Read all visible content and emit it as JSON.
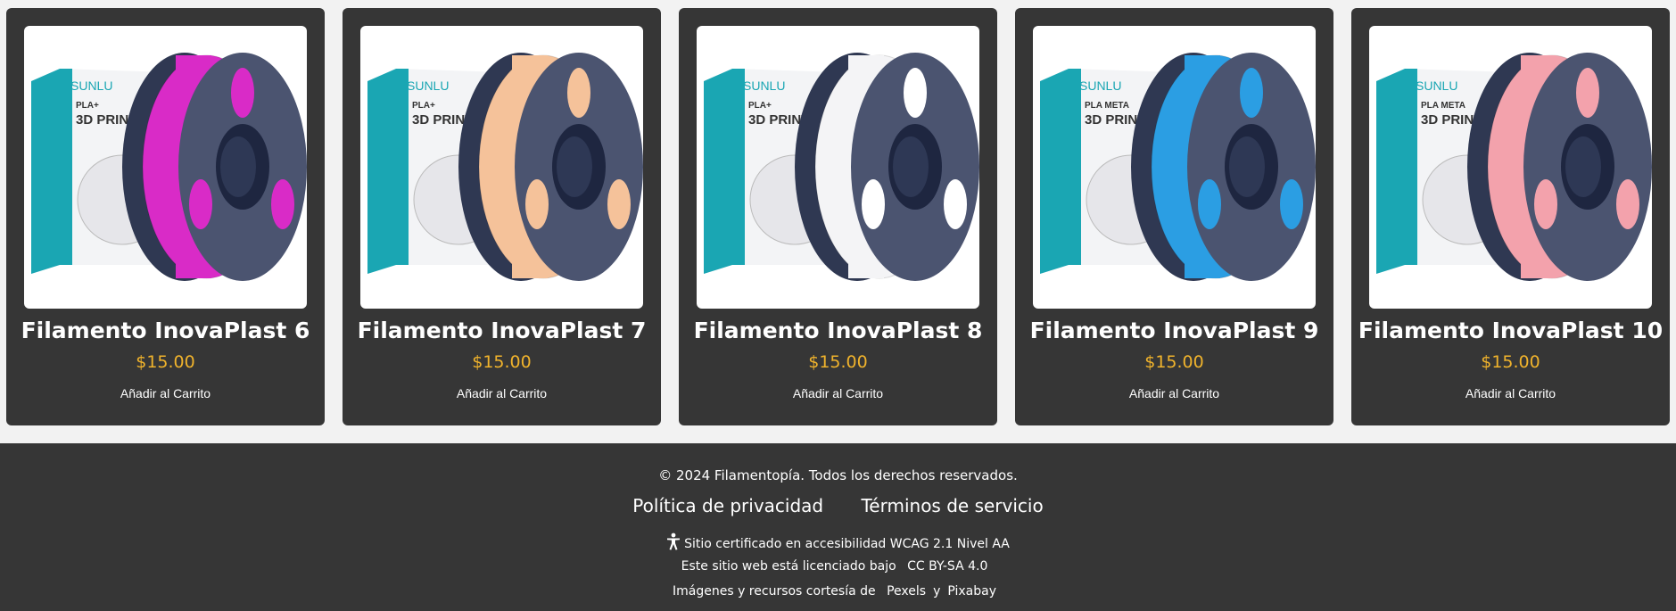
{
  "products": [
    {
      "title": "Filamento InovaPlast 6",
      "price": "$15.00",
      "button": "Añadir al Carrito",
      "color": "#d92bc7",
      "hub": "#d92bc7",
      "box_brand": "SUNLU",
      "box_line1": "PLA+",
      "box_line2": "3D PRINTIN"
    },
    {
      "title": "Filamento InovaPlast 7",
      "price": "$15.00",
      "button": "Añadir al Carrito",
      "color": "#f5c29a",
      "hub": "#f5c29a",
      "box_brand": "SUNLU",
      "box_line1": "PLA+",
      "box_line2": "3D PRINTIN"
    },
    {
      "title": "Filamento InovaPlast 8",
      "price": "$15.00",
      "button": "Añadir al Carrito",
      "color": "#f4f4f6",
      "hub": "#ffffff",
      "box_brand": "SUNLU",
      "box_line1": "PLA+",
      "box_line2": "3D PRINTIN"
    },
    {
      "title": "Filamento InovaPlast 9",
      "price": "$15.00",
      "button": "Añadir al Carrito",
      "color": "#2b9ee3",
      "hub": "#2b9ee3",
      "box_brand": "SUNLU",
      "box_line1": "PLA META",
      "box_line2": "3D PRINT"
    },
    {
      "title": "Filamento InovaPlast 10",
      "price": "$15.00",
      "button": "Añadir al Carrito",
      "color": "#f3a2ac",
      "hub": "#f3a2ac",
      "box_brand": "SUNLU",
      "box_line1": "PLA META",
      "box_line2": "3D PRINT"
    }
  ],
  "footer": {
    "copyright": "© 2024 Filamentopía. Todos los derechos reservados.",
    "privacy": "Política de privacidad",
    "terms": "Términos de servicio",
    "wcag": "Sitio certificado en accesibilidad WCAG 2.1 Nivel AA",
    "license_text": "Este sitio web está licenciado bajo",
    "license_link": "CC BY-SA 4.0",
    "credits_text": "Imágenes y recursos cortesía de",
    "credits_pexels": "Pexels",
    "credits_and": "y",
    "credits_pixabay": "Pixabay"
  },
  "colors": {
    "card_bg": "#363636",
    "price": "#f0b32c",
    "page_bg": "#f2f2f2"
  },
  "icons": {
    "accessibility": "accessibility-icon"
  }
}
